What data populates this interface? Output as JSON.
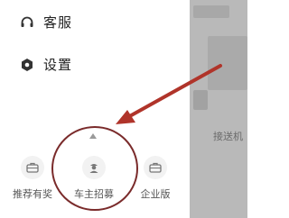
{
  "drawer": {
    "menu": [
      {
        "label": "客服",
        "icon": "headset-icon"
      },
      {
        "label": "设置",
        "icon": "gear-icon"
      }
    ],
    "bottom_tabs": [
      {
        "label": "推荐有奖",
        "icon": "briefcase-icon"
      },
      {
        "label": "车主招募",
        "icon": "driver-icon"
      },
      {
        "label": "企业版",
        "icon": "briefcase-icon",
        "badge": true
      }
    ]
  },
  "background": {
    "text": "接送机"
  },
  "colors": {
    "annotation": "#b0342a",
    "badge": "#f04a4a",
    "icon": "#333333",
    "tab_icon": "#777777"
  }
}
